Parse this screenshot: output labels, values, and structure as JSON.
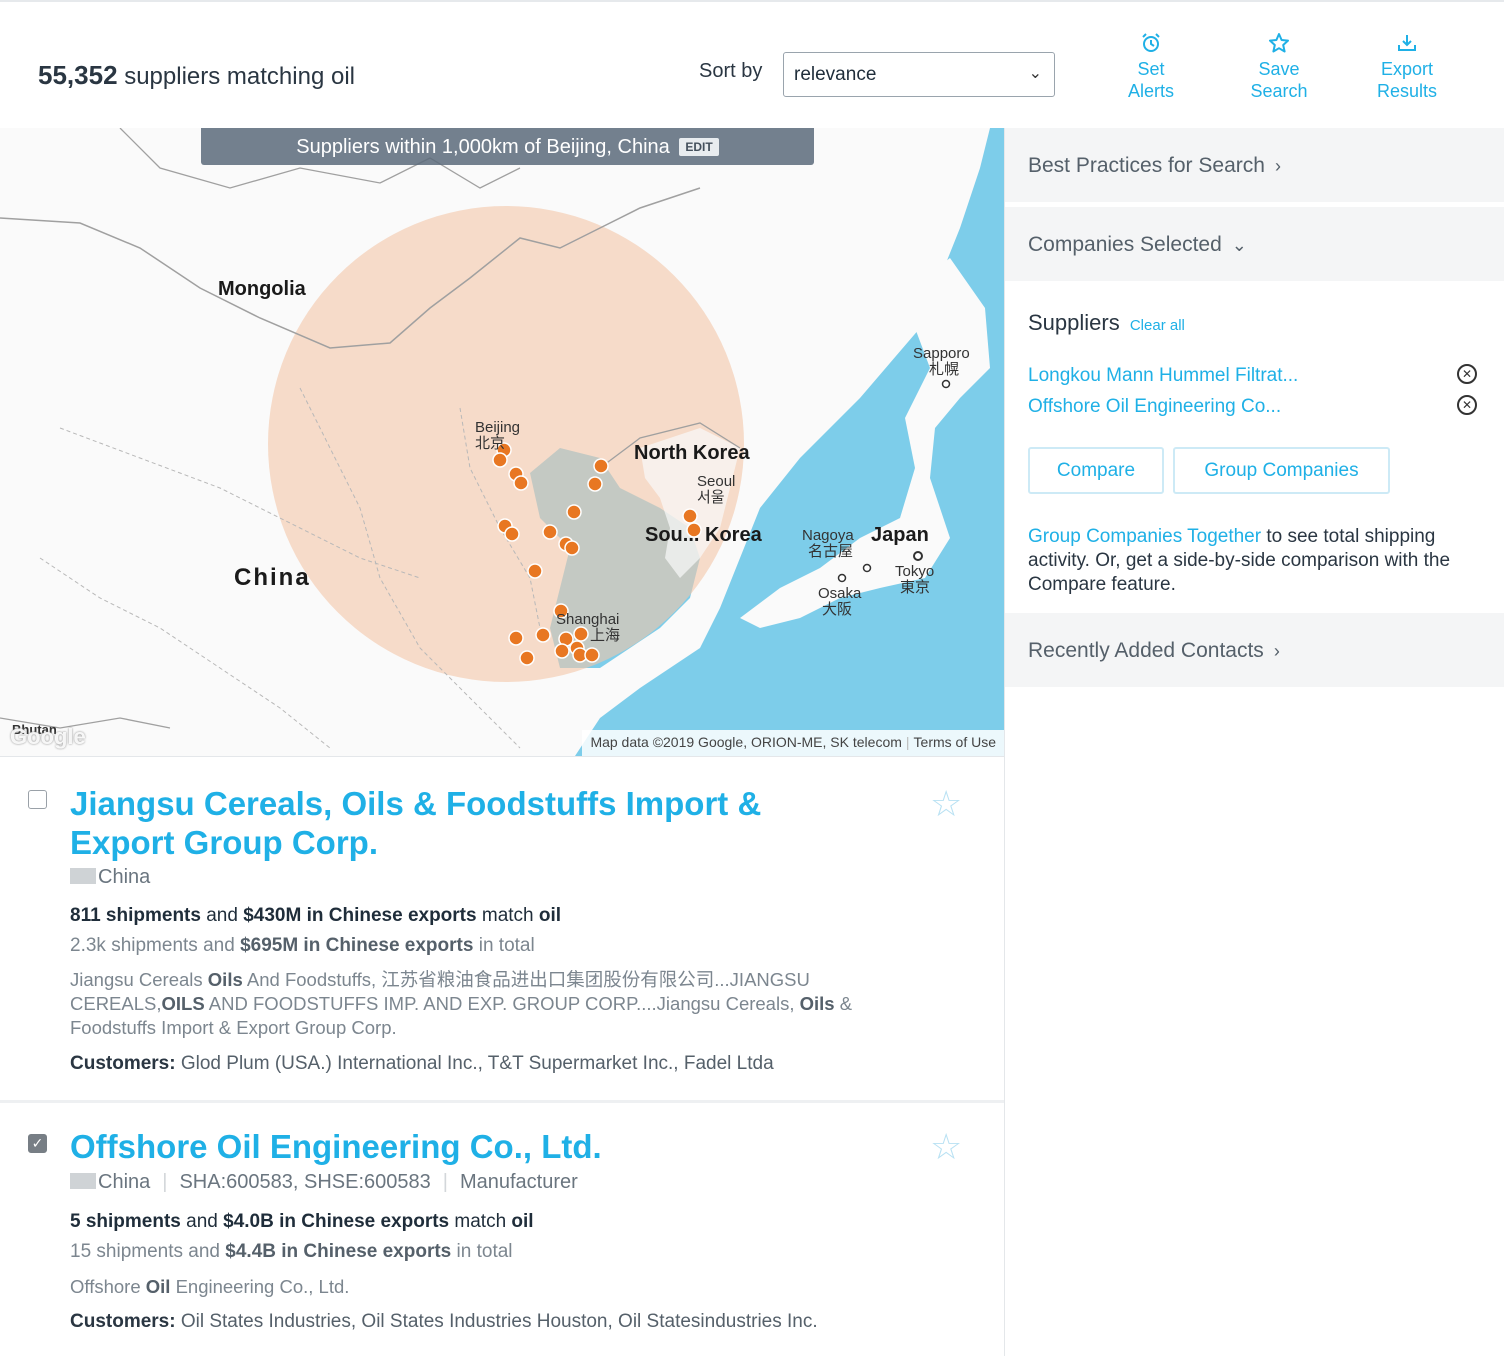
{
  "header": {
    "count": "55,352",
    "count_suffix": "suppliers matching oil",
    "sort_label": "Sort by",
    "sort_value": "relevance",
    "actions": [
      {
        "icon": "alarm-clock-icon",
        "line1": "Set",
        "line2": "Alerts"
      },
      {
        "icon": "star-outline-icon",
        "line1": "Save",
        "line2": "Search"
      },
      {
        "icon": "download-icon",
        "line1": "Export",
        "line2": "Results"
      }
    ]
  },
  "map": {
    "banner": "Suppliers within 1,000km of Beijing, China",
    "edit_label": "EDIT",
    "labels": {
      "mongolia": "Mongolia",
      "china": "China",
      "north_korea": "North Korea",
      "south_korea": "Sou... Korea",
      "japan": "Japan",
      "beijing": "Beijing",
      "beijing_cn": "北京",
      "seoul": "Seoul",
      "seoul_kr": "서울",
      "shanghai": "Shanghai",
      "shanghai_cn": "上海",
      "sapporo": "Sapporo",
      "sapporo_jp": "札幌",
      "nagoya": "Nagoya",
      "nagoya_jp": "名古屋",
      "osaka": "Osaka",
      "osaka_jp": "大阪",
      "tokyo": "Tokyo",
      "tokyo_jp": "東京",
      "bhutan": "Bhutan"
    },
    "google": "Google",
    "attribution": "Map data ©2019 Google, ORION-ME, SK telecom",
    "terms": "Terms of Use",
    "colors": {
      "radius_fill": "#f8dccb",
      "sea": "#7dcdea",
      "marker": "#e87722"
    }
  },
  "results": [
    {
      "checked": false,
      "title": "Jiangsu Cereals, Oils & Foodstuffs Import & Export Group Corp.",
      "country": "China",
      "match_shipments": "811 shipments",
      "match_and": "and",
      "match_value": "$430M in Chinese exports",
      "match_text": "match",
      "match_term": "oil",
      "total_shipments": "2.3k shipments",
      "total_and": "and",
      "total_value": "$695M in Chinese exports",
      "total_suffix": "in total",
      "desc": [
        {
          "t": "Jiangsu Cereals ",
          "b": false
        },
        {
          "t": "Oils",
          "b": true
        },
        {
          "t": " And Foodstuffs, 江苏省粮油食品进出口集团股份有限公司...JIANGSU CEREALS,",
          "b": false
        },
        {
          "t": "OILS",
          "b": true
        },
        {
          "t": " AND FOODSTUFFS IMP. AND EXP. GROUP CORP....Jiangsu Cereals, ",
          "b": false
        },
        {
          "t": "Oils",
          "b": true
        },
        {
          "t": " & Foodstuffs Import & Export Group Corp.",
          "b": false
        }
      ],
      "customers_label": "Customers:",
      "customers": "Glod Plum (USA.) International Inc., T&T Supermarket Inc., Fadel Ltda"
    },
    {
      "checked": true,
      "title": "Offshore Oil Engineering Co., Ltd.",
      "country": "China",
      "tickers": "SHA:600583, SHSE:600583",
      "type": "Manufacturer",
      "match_shipments": "5 shipments",
      "match_and": "and",
      "match_value": "$4.0B in Chinese exports",
      "match_text": "match",
      "match_term": "oil",
      "total_shipments": "15 shipments",
      "total_and": "and",
      "total_value": "$4.4B in Chinese exports",
      "total_suffix": "in total",
      "desc": [
        {
          "t": "Offshore ",
          "b": false
        },
        {
          "t": "Oil",
          "b": true
        },
        {
          "t": " Engineering Co., Ltd.",
          "b": false
        }
      ],
      "customers_label": "Customers:",
      "customers": "Oil States Industries, Oil States Industries Houston, Oil Statesindustries Inc."
    }
  ],
  "sidebar": {
    "best_practices": "Best Practices for Search",
    "companies_selected": "Companies Selected",
    "suppliers_title": "Suppliers",
    "clear_all": "Clear all",
    "suppliers": [
      "Longkou Mann Hummel Filtrat...",
      "Offshore Oil Engineering Co..."
    ],
    "compare_button": "Compare",
    "group_button": "Group Companies",
    "note_link": "Group Companies Together",
    "note_text": " to see total shipping activity. Or, get a side-by-side comparison with the Compare feature.",
    "recently_added": "Recently Added Contacts"
  }
}
